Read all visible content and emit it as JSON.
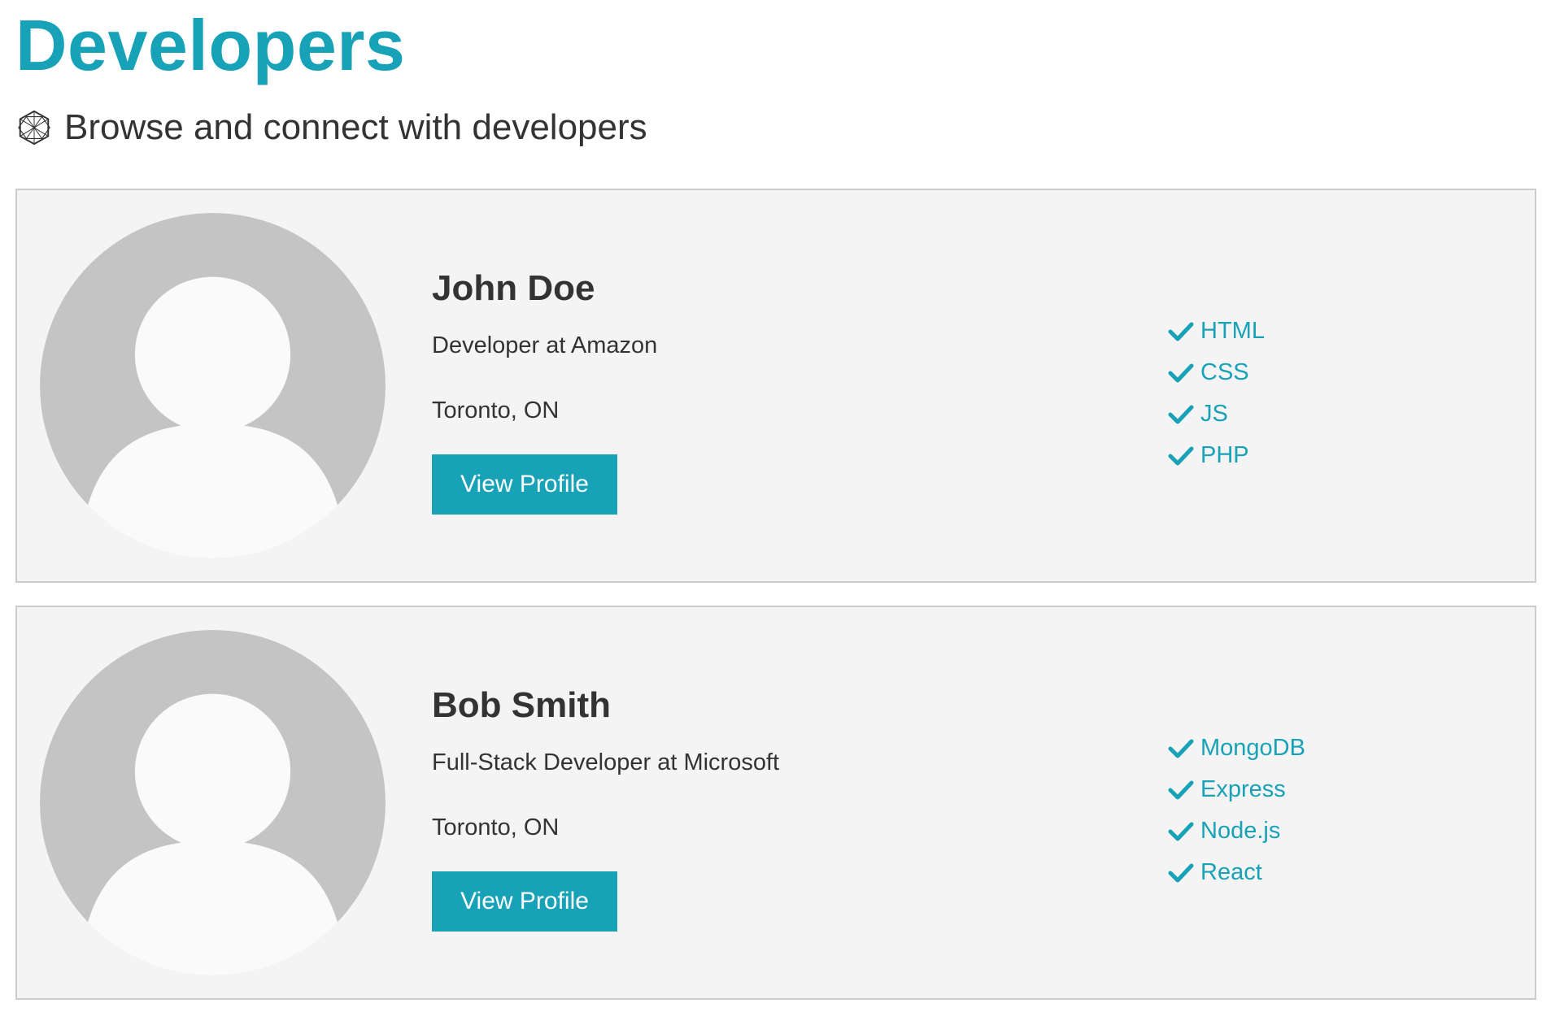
{
  "header": {
    "title": "Developers",
    "lead_icon": "network-icon",
    "lead_text": "Browse and connect with developers"
  },
  "colors": {
    "accent": "#17a2b8",
    "card_background": "#f4f4f4",
    "card_border": "#cccccc",
    "avatar_background": "#c4c4c4",
    "avatar_figure": "#fafafa"
  },
  "profiles": [
    {
      "avatar_icon": "default-avatar-icon",
      "name": "John Doe",
      "role": "Developer at Amazon",
      "location": "Toronto, ON",
      "button_label": "View Profile",
      "skill_icon": "check-icon",
      "skills": [
        "HTML",
        "CSS",
        "JS",
        "PHP"
      ]
    },
    {
      "avatar_icon": "default-avatar-icon",
      "name": "Bob Smith",
      "role": "Full-Stack Developer at Microsoft",
      "location": "Toronto, ON",
      "button_label": "View Profile",
      "skill_icon": "check-icon",
      "skills": [
        "MongoDB",
        "Express",
        "Node.js",
        "React"
      ]
    }
  ]
}
